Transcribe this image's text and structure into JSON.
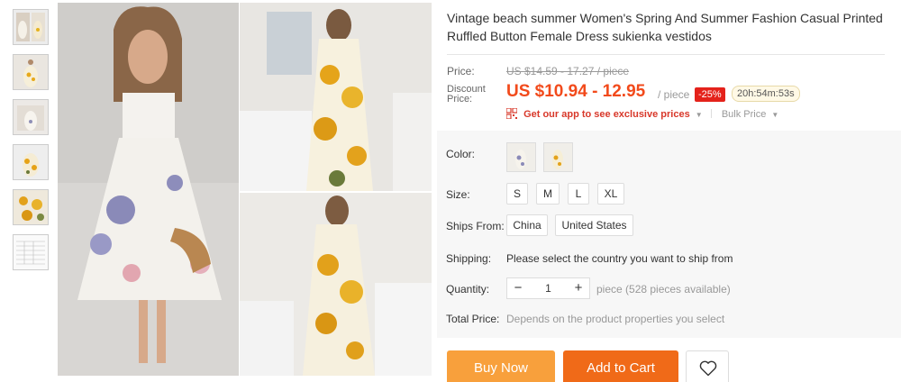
{
  "product": {
    "title": "Vintage beach summer Women's Spring And Summer Fashion Casual Printed Ruffled Button Female Dress sukienka vestidos"
  },
  "pricing": {
    "price_label": "Price:",
    "original_price": "US $14.59 - 17.27 / piece",
    "discount_label": "Discount Price:",
    "discount_price": "US $10.94 - 12.95",
    "per_unit": "/ piece",
    "discount_pct": "-25%",
    "countdown": "20h:54m:53s",
    "app_prompt": "Get our app to see exclusive prices",
    "bulk_price": "Bulk Price"
  },
  "options": {
    "color_label": "Color:",
    "size_label": "Size:",
    "sizes": [
      "S",
      "M",
      "L",
      "XL"
    ],
    "ships_from_label": "Ships From:",
    "ships_from": [
      "China",
      "United States"
    ],
    "shipping_label": "Shipping:",
    "shipping_text": "Please select the country you want to ship from",
    "quantity_label": "Quantity:",
    "quantity_value": "1",
    "quantity_info": "piece (528 pieces available)",
    "total_label": "Total Price:",
    "total_text": "Depends on the product properties you select"
  },
  "actions": {
    "buy_now": "Buy Now",
    "add_to_cart": "Add to Cart"
  },
  "colors": {
    "price_red": "#f24a1b",
    "buy_orange": "#f8a03c",
    "cart_orange": "#f06a18",
    "badge_red": "#e4221b"
  }
}
